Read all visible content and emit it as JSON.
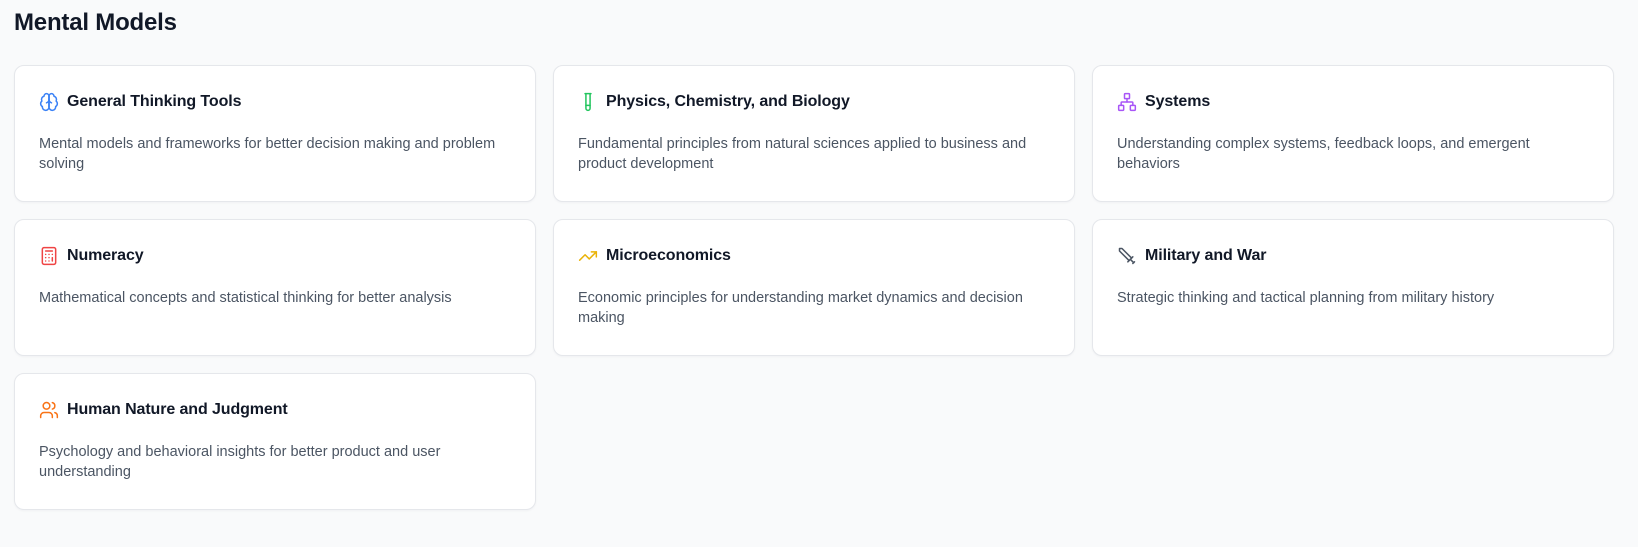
{
  "page": {
    "title": "Mental Models"
  },
  "cards": [
    {
      "icon": "brain-icon",
      "icon_color": "#3b82f6",
      "title": "General Thinking Tools",
      "description": "Mental models and frameworks for better decision making and problem solving"
    },
    {
      "icon": "test-tube-icon",
      "icon_color": "#22c55e",
      "title": "Physics, Chemistry, and Biology",
      "description": "Fundamental principles from natural sciences applied to business and product development"
    },
    {
      "icon": "network-icon",
      "icon_color": "#a855f7",
      "title": "Systems",
      "description": "Understanding complex systems, feedback loops, and emergent behaviors"
    },
    {
      "icon": "calculator-icon",
      "icon_color": "#ef4444",
      "title": "Numeracy",
      "description": "Mathematical concepts and statistical thinking for better analysis"
    },
    {
      "icon": "trending-up-icon",
      "icon_color": "#eab308",
      "title": "Microeconomics",
      "description": "Economic principles for understanding market dynamics and decision making"
    },
    {
      "icon": "sword-icon",
      "icon_color": "#4b5563",
      "title": "Military and War",
      "description": "Strategic thinking and tactical planning from military history"
    },
    {
      "icon": "users-icon",
      "icon_color": "#f97316",
      "title": "Human Nature and Judgment",
      "description": "Psychology and behavioral insights for better product and user understanding"
    }
  ]
}
